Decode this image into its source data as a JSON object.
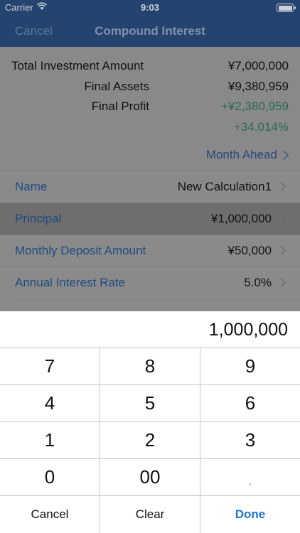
{
  "status_bar": {
    "carrier": "Carrier",
    "time": "9:03"
  },
  "nav": {
    "cancel_label": "Cancel",
    "title": "Compound Interest"
  },
  "summary": {
    "total_investment_label": "Total Investment Amount",
    "total_investment_value": "¥7,000,000",
    "final_assets_label": "Final Assets",
    "final_assets_value": "¥9,380,959",
    "final_profit_label": "Final Profit",
    "final_profit_value": "+¥2,380,959",
    "final_profit_percent": "+34.014%",
    "month_ahead_label": "Month Ahead"
  },
  "list": [
    {
      "label": "Name",
      "value": "New Calculation1"
    },
    {
      "label": "Principal",
      "value": "¥1,000,000"
    },
    {
      "label": "Monthly Deposit Amount",
      "value": "¥50,000"
    },
    {
      "label": "Annual Interest Rate",
      "value": "5.0%"
    }
  ],
  "keypad": {
    "display_value": "1,000,000",
    "keys": [
      "7",
      "8",
      "9",
      "4",
      "5",
      "6",
      "1",
      "2",
      "3",
      "0",
      "00",
      "."
    ],
    "cancel_label": "Cancel",
    "clear_label": "Clear",
    "done_label": "Done"
  },
  "colors": {
    "nav_background": "#24446f",
    "label_blue": "#1f4a82",
    "profit_green": "#2b6a55",
    "done_blue": "#1a73d8"
  }
}
